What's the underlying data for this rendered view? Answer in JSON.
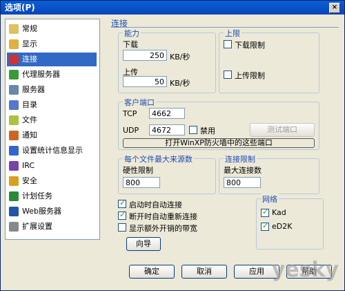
{
  "window": {
    "title": "选项(P)",
    "close_symbol": "×"
  },
  "nav": {
    "items": [
      {
        "label": "常规",
        "icon": "general-icon",
        "color": "#e0c060"
      },
      {
        "label": "显示",
        "icon": "display-icon",
        "color": "#e0b040"
      },
      {
        "label": "连接",
        "icon": "connection-icon",
        "color": "#cc3333",
        "selected": true
      },
      {
        "label": "代理服务器",
        "icon": "proxy-icon",
        "color": "#3a9a3a"
      },
      {
        "label": "服务器",
        "icon": "server-icon",
        "color": "#6688aa"
      },
      {
        "label": "目录",
        "icon": "folder-icon",
        "color": "#5577cc"
      },
      {
        "label": "文件",
        "icon": "file-icon",
        "color": "#b0c040"
      },
      {
        "label": "通知",
        "icon": "notify-icon",
        "color": "#cc6622"
      },
      {
        "label": "设置统计信息显示",
        "icon": "stats-icon",
        "color": "#3366cc"
      },
      {
        "label": "IRC",
        "icon": "irc-icon",
        "color": "#7744aa"
      },
      {
        "label": "安全",
        "icon": "security-icon",
        "color": "#d8a020"
      },
      {
        "label": "计划任务",
        "icon": "scheduler-icon",
        "color": "#2a8a3a"
      },
      {
        "label": "Web服务器",
        "icon": "webserver-icon",
        "color": "#2255aa"
      },
      {
        "label": "扩展设置",
        "icon": "extended-icon",
        "color": "#888888"
      }
    ]
  },
  "panel": {
    "header": "连接",
    "capacity": {
      "title": "能力",
      "download_label": "下载",
      "download_value": "250",
      "upload_label": "上传",
      "upload_value": "50",
      "unit": "KB/秒"
    },
    "limit": {
      "title": "上限",
      "download_limit": "下载限制",
      "upload_limit": "上传限制"
    },
    "client_port": {
      "title": "客户端口",
      "tcp_label": "TCP",
      "tcp_value": "4662",
      "udp_label": "UDP",
      "udp_value": "4672",
      "disable_label": "禁用",
      "test_button": "测试端口",
      "firewall_button": "打开WinXP防火墙中的这些端口"
    },
    "max_sources": {
      "title": "每个文件最大来源数",
      "hard_limit": "硬性限制",
      "value": "800"
    },
    "conn_limit": {
      "title": "连接限制",
      "max_conn": "最大连接数",
      "value": "800"
    },
    "options": {
      "auto_connect": "启动时自动连接",
      "reconnect": "断开时自动重新连接",
      "show_overhead": "显示额外开销的带宽"
    },
    "network": {
      "title": "网络",
      "kad": "Kad",
      "ed2k": "eD2K"
    },
    "wizard_button": "向导"
  },
  "footer": {
    "ok": "确定",
    "cancel": "取消",
    "apply": "应用",
    "help": "帮助"
  },
  "watermark": "yesky"
}
